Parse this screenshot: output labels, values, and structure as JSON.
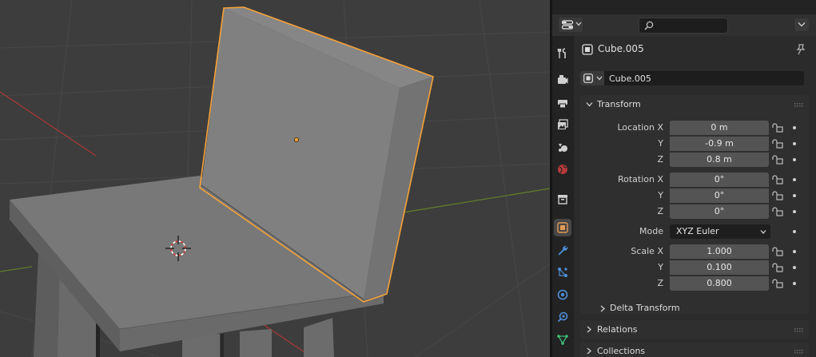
{
  "viewport": {
    "colors": {
      "background": "#3d3d3d",
      "selection_outline": "#f5a137",
      "x_axis": "#a83838",
      "y_axis": "#5f7c2a"
    }
  },
  "properties": {
    "header": {
      "editor_icon": "properties-editor-icon",
      "search_placeholder": ""
    },
    "tabs": [
      {
        "name": "tool-tab",
        "icon": "tool-icon",
        "active": false
      },
      {
        "name": "render-tab",
        "icon": "render-camera-icon",
        "active": false
      },
      {
        "name": "output-tab",
        "icon": "printer-icon",
        "active": false
      },
      {
        "name": "view-layer-tab",
        "icon": "image-stack-icon",
        "active": false
      },
      {
        "name": "scene-tab",
        "icon": "scene-icon",
        "active": false
      },
      {
        "name": "world-tab",
        "icon": "world-icon",
        "active": false
      },
      {
        "name": "collection-tab",
        "icon": "box-icon",
        "active": false
      },
      {
        "name": "object-tab",
        "icon": "object-icon",
        "active": true
      },
      {
        "name": "modifiers-tab",
        "icon": "wrench-icon",
        "active": false
      },
      {
        "name": "particles-tab",
        "icon": "particles-icon",
        "active": false
      },
      {
        "name": "physics-tab",
        "icon": "physics-icon",
        "active": false
      },
      {
        "name": "constraints-tab",
        "icon": "constraint-icon",
        "active": false
      },
      {
        "name": "data-tab",
        "icon": "mesh-data-icon",
        "active": false
      }
    ],
    "context": {
      "object_name": "Cube.005"
    },
    "name_field": {
      "value": "Cube.005"
    },
    "transform": {
      "title": "Transform",
      "location": {
        "label": "Location X",
        "y_label": "Y",
        "z_label": "Z",
        "x": "0 m",
        "y": "-0.9 m",
        "z": "0.8 m"
      },
      "rotation": {
        "label": "Rotation X",
        "y_label": "Y",
        "z_label": "Z",
        "x": "0°",
        "y": "0°",
        "z": "0°"
      },
      "mode": {
        "label": "Mode",
        "value": "XYZ Euler"
      },
      "scale": {
        "label": "Scale X",
        "y_label": "Y",
        "z_label": "Z",
        "x": "1.000",
        "y": "0.100",
        "z": "0.800"
      },
      "delta_title": "Delta Transform"
    },
    "relations": {
      "title": "Relations"
    },
    "collections": {
      "title": "Collections"
    },
    "colors": {
      "panel_bg": "#2f2f2f",
      "field_bg": "#545454",
      "active_tab": "#474747",
      "object_orange": "#e39a52"
    }
  }
}
